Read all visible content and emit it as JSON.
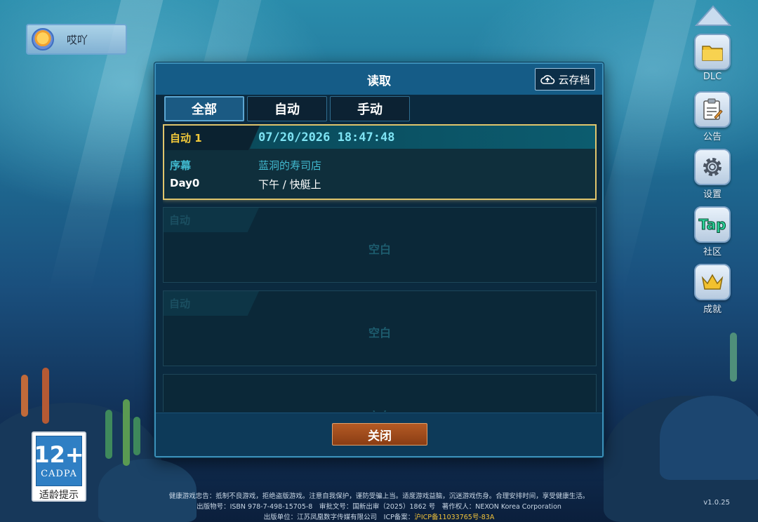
{
  "user": {
    "name": "哎吖"
  },
  "dialog": {
    "title": "读取",
    "cloud_button": "云存档",
    "tabs": [
      {
        "label": "全部",
        "active": true
      },
      {
        "label": "自动",
        "active": false
      },
      {
        "label": "手动",
        "active": false
      }
    ],
    "slots": [
      {
        "tag": "自动 1",
        "datetime": "07/20/2026 18:47:48",
        "chapter": "序幕",
        "place": "蓝洞的寿司店",
        "day": "Day0",
        "time": "下午 / 快艇上",
        "selected": true
      },
      {
        "tag": "自动",
        "empty_text": "空白"
      },
      {
        "tag": "自动",
        "empty_text": "空白"
      },
      {
        "tag": "",
        "empty_text": "空白"
      }
    ],
    "close_button": "关闭"
  },
  "side_menu": [
    {
      "label": "DLC",
      "icon": "folder-icon"
    },
    {
      "label": "公告",
      "icon": "notice-icon"
    },
    {
      "label": "设置",
      "icon": "gear-icon"
    },
    {
      "label": "社区",
      "icon": "tap-icon",
      "icon_text": "Tap"
    },
    {
      "label": "成就",
      "icon": "crown-icon"
    }
  ],
  "age_rating": {
    "number": "12+",
    "org": "CADPA",
    "tip": "适龄提示"
  },
  "legal": {
    "line1": "健康游戏忠告：抵制不良游戏，拒绝盗版游戏。注意自我保护，谨防受骗上当。适度游戏益脑，沉迷游戏伤身。合理安排时间，享受健康生活。",
    "line2": "出版物号：ISBN 978-7-498-15705-8　审批文号：国新出审（2025）1862 号　著作权人：NEXON Korea Corporation",
    "line3_prefix": "出版单位：江苏凤凰数字传媒有限公司　ICP备案：",
    "line3_icp": "沪ICP备11033765号-83A"
  },
  "version": "v1.0.25",
  "colors": {
    "accent_gold": "#f2c93a",
    "header_blue": "#155c87",
    "close_orange": "#a24d1c",
    "text_cyan": "#41b9cf"
  }
}
